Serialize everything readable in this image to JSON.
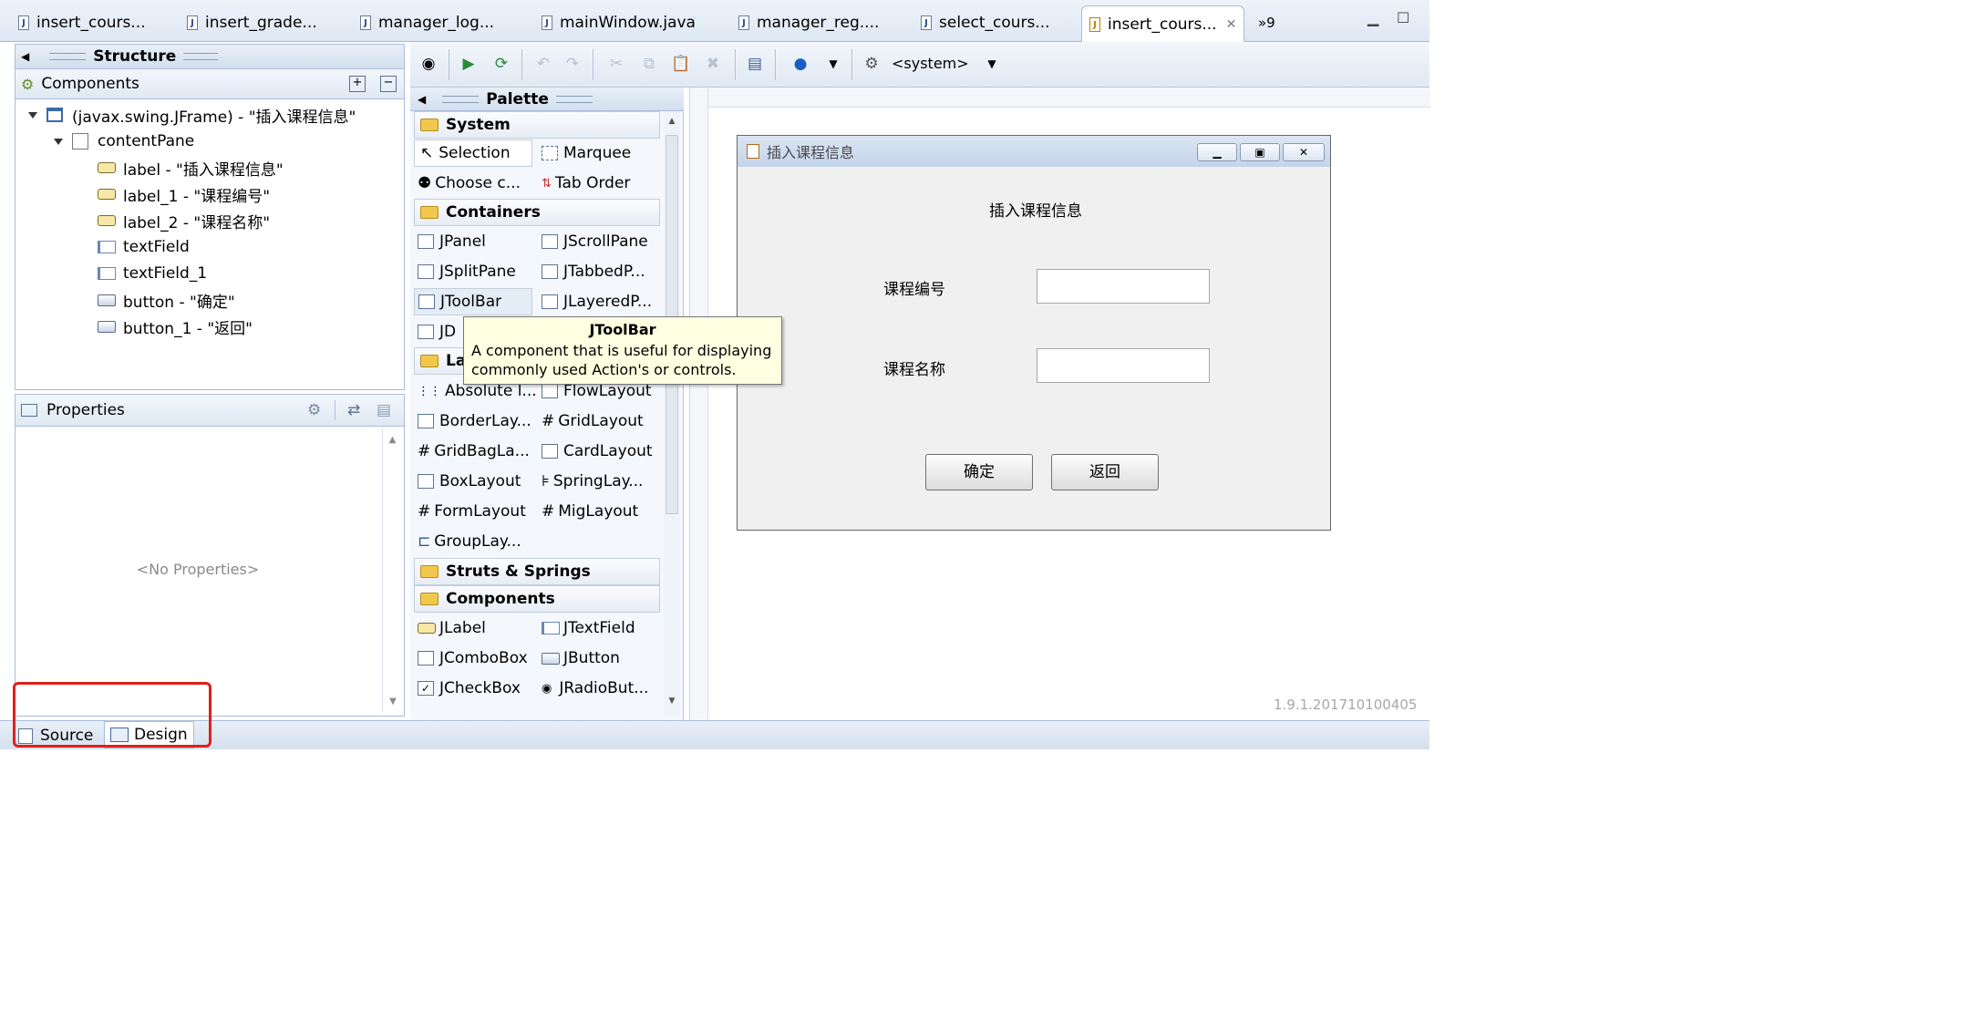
{
  "tabs": [
    {
      "label": "insert_cours...",
      "icon": "java-file-icon"
    },
    {
      "label": "insert_grade...",
      "icon": "java-file-icon"
    },
    {
      "label": "manager_log...",
      "icon": "java-file-icon"
    },
    {
      "label": "mainWindow.java",
      "icon": "java-file-icon"
    },
    {
      "label": "manager_reg....",
      "icon": "java-file-icon"
    },
    {
      "label": "select_cours...",
      "icon": "java-file-icon"
    },
    {
      "label": "insert_cours...",
      "icon": "windowbuilder-file-icon",
      "active": true
    }
  ],
  "tabs_overflow": "»9",
  "structure": {
    "title": "Structure",
    "components_title": "Components",
    "tree": [
      {
        "label": "(javax.swing.JFrame) - \"插入课程信息\"",
        "icon": "jframe-icon"
      },
      {
        "label": "contentPane",
        "icon": "panel-icon"
      },
      {
        "label": "label - \"插入课程信息\"",
        "icon": "jlabel-icon"
      },
      {
        "label": "label_1 - \"课程编号\"",
        "icon": "jlabel-icon"
      },
      {
        "label": "label_2 - \"课程名称\"",
        "icon": "jlabel-icon"
      },
      {
        "label": "textField",
        "icon": "jtextfield-icon"
      },
      {
        "label": "textField_1",
        "icon": "jtextfield-icon"
      },
      {
        "label": "button - \"确定\"",
        "icon": "jbutton-icon"
      },
      {
        "label": "button_1 - \"返回\"",
        "icon": "jbutton-icon"
      }
    ]
  },
  "properties": {
    "title": "Properties",
    "empty_text": "<No Properties>"
  },
  "toolbar": {
    "system_label": "<system>"
  },
  "palette": {
    "title": "Palette",
    "categories": {
      "system": "System",
      "containers": "Containers",
      "layouts_partial": "La",
      "struts": "Struts & Springs",
      "components": "Components"
    },
    "system_items": [
      "Selection",
      "Marquee",
      "Choose c...",
      "Tab Order"
    ],
    "container_items": [
      "JPanel",
      "JScrollPane",
      "JSplitPane",
      "JTabbedP...",
      "JToolBar",
      "JLayeredP...",
      "JD"
    ],
    "layout_items": [
      "Absolute l...",
      "FlowLayout",
      "BorderLay...",
      "GridLayout",
      "GridBagLa...",
      "CardLayout",
      "BoxLayout",
      "SpringLay...",
      "FormLayout",
      "MigLayout",
      "GroupLay..."
    ],
    "component_items": [
      "JLabel",
      "JTextField",
      "JComboBox",
      "JButton",
      "JCheckBox",
      "JRadioBut..."
    ]
  },
  "tooltip": {
    "title": "JToolBar",
    "text": "A component that is useful for displaying commonly used Action's or controls."
  },
  "design": {
    "frame_title": "插入课程信息",
    "heading": "插入课程信息",
    "label_code": "课程编号",
    "label_name": "课程名称",
    "ok_button": "确定",
    "back_button": "返回"
  },
  "version": "1.9.1.201710100405",
  "bottom_tabs": {
    "source": "Source",
    "design": "Design"
  },
  "colors": {
    "highlight_box": "#e0201c",
    "panel_header": "#d3dfee",
    "tooltip_bg": "#ffffe1"
  }
}
